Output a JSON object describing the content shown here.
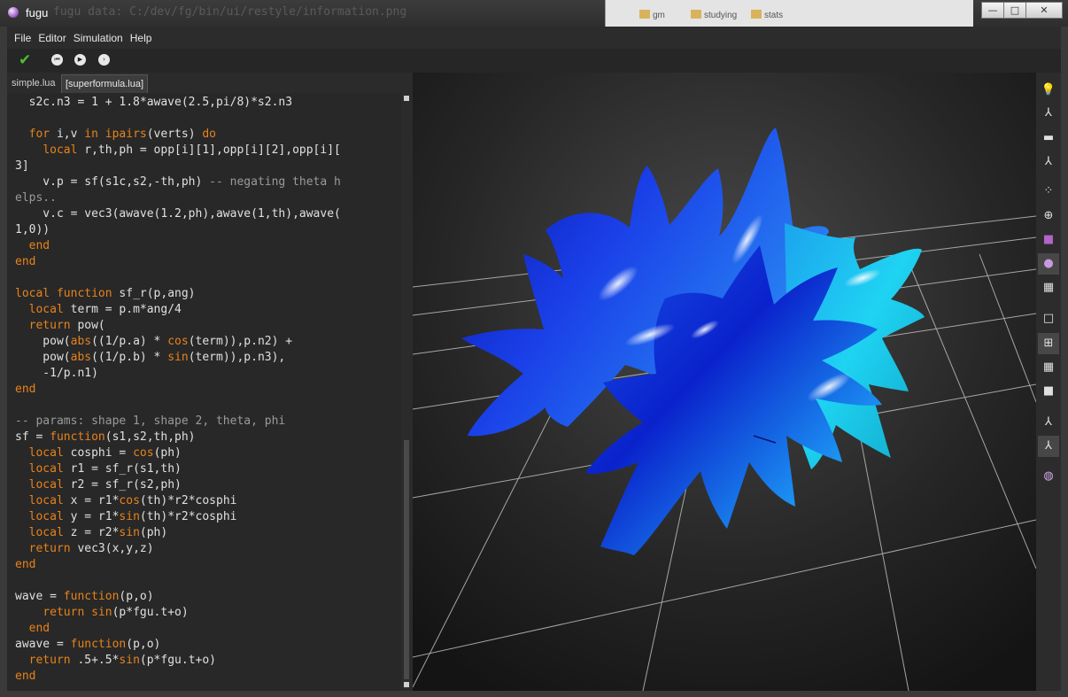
{
  "window": {
    "title": "fugu",
    "background_path_text": "fugu data: C:/dev/fg/bin/ui/restyle/information.png",
    "behind_tabs": [
      "gm",
      "studying",
      "stats"
    ],
    "controls": {
      "minimize": "—",
      "maximize": "□",
      "close": "✕"
    }
  },
  "menubar": {
    "items": [
      "File",
      "Editor",
      "Simulation",
      "Help"
    ]
  },
  "toolbar": {
    "check_icon": "check-icon",
    "buttons": [
      "restart-icon",
      "play-icon",
      "step-icon"
    ]
  },
  "tabs": [
    {
      "label": "simple.lua",
      "active": false
    },
    {
      "label": "[superformula.lua]",
      "active": true
    }
  ],
  "editor": {
    "lines": [
      [
        {
          "t": "  s2c.n3 = 1 + 1.8*awave(2.5,pi/8)*s2.n3",
          "c": ""
        }
      ],
      [
        {
          "t": "",
          "c": ""
        }
      ],
      [
        {
          "t": "  ",
          "c": ""
        },
        {
          "t": "for",
          "c": "kw"
        },
        {
          "t": " i,v ",
          "c": ""
        },
        {
          "t": "in",
          "c": "kw"
        },
        {
          "t": " ",
          "c": ""
        },
        {
          "t": "ipairs",
          "c": "kw"
        },
        {
          "t": "(verts) ",
          "c": ""
        },
        {
          "t": "do",
          "c": "kw"
        }
      ],
      [
        {
          "t": "    ",
          "c": ""
        },
        {
          "t": "local",
          "c": "kw"
        },
        {
          "t": " r,th,ph = opp[i][1],opp[i][2],opp[i][",
          "c": ""
        }
      ],
      [
        {
          "t": "3]",
          "c": ""
        }
      ],
      [
        {
          "t": "    v.p = sf(s1c,s2,-th,ph) ",
          "c": ""
        },
        {
          "t": "-- negating theta h",
          "c": "cm"
        }
      ],
      [
        {
          "t": "elps..",
          "c": "cm"
        }
      ],
      [
        {
          "t": "    v.c = vec3(awave(1.2,ph),awave(1,th),awave(",
          "c": ""
        }
      ],
      [
        {
          "t": "1,0))",
          "c": ""
        }
      ],
      [
        {
          "t": "  ",
          "c": ""
        },
        {
          "t": "end",
          "c": "kw"
        }
      ],
      [
        {
          "t": "end",
          "c": "kw"
        }
      ],
      [
        {
          "t": "",
          "c": ""
        }
      ],
      [
        {
          "t": "local",
          "c": "kw"
        },
        {
          "t": " ",
          "c": ""
        },
        {
          "t": "function",
          "c": "kw"
        },
        {
          "t": " sf_r(p,ang)",
          "c": ""
        }
      ],
      [
        {
          "t": "  ",
          "c": ""
        },
        {
          "t": "local",
          "c": "kw"
        },
        {
          "t": " term = p.m*ang/4",
          "c": ""
        }
      ],
      [
        {
          "t": "  ",
          "c": ""
        },
        {
          "t": "return",
          "c": "kw"
        },
        {
          "t": " pow(",
          "c": ""
        }
      ],
      [
        {
          "t": "    pow(",
          "c": ""
        },
        {
          "t": "abs",
          "c": "kw"
        },
        {
          "t": "((1/p.a) * ",
          "c": ""
        },
        {
          "t": "cos",
          "c": "kw"
        },
        {
          "t": "(term)),p.n2) +",
          "c": ""
        }
      ],
      [
        {
          "t": "    pow(",
          "c": ""
        },
        {
          "t": "abs",
          "c": "kw"
        },
        {
          "t": "((1/p.b) * ",
          "c": ""
        },
        {
          "t": "sin",
          "c": "kw"
        },
        {
          "t": "(term)),p.n3),",
          "c": ""
        }
      ],
      [
        {
          "t": "    -1/p.n1)",
          "c": ""
        }
      ],
      [
        {
          "t": "end",
          "c": "kw"
        }
      ],
      [
        {
          "t": "",
          "c": ""
        }
      ],
      [
        {
          "t": "-- params: shape 1, shape 2, theta, phi",
          "c": "cm"
        }
      ],
      [
        {
          "t": "sf = ",
          "c": ""
        },
        {
          "t": "function",
          "c": "kw"
        },
        {
          "t": "(s1,s2,th,ph)",
          "c": ""
        }
      ],
      [
        {
          "t": "  ",
          "c": ""
        },
        {
          "t": "local",
          "c": "kw"
        },
        {
          "t": " cosphi = ",
          "c": ""
        },
        {
          "t": "cos",
          "c": "kw"
        },
        {
          "t": "(ph)",
          "c": ""
        }
      ],
      [
        {
          "t": "  ",
          "c": ""
        },
        {
          "t": "local",
          "c": "kw"
        },
        {
          "t": " r1 = sf_r(s1,th)",
          "c": ""
        }
      ],
      [
        {
          "t": "  ",
          "c": ""
        },
        {
          "t": "local",
          "c": "kw"
        },
        {
          "t": " r2 = sf_r(s2,ph)",
          "c": ""
        }
      ],
      [
        {
          "t": "  ",
          "c": ""
        },
        {
          "t": "local",
          "c": "kw"
        },
        {
          "t": " x = r1*",
          "c": ""
        },
        {
          "t": "cos",
          "c": "kw"
        },
        {
          "t": "(th)*r2*cosphi",
          "c": ""
        }
      ],
      [
        {
          "t": "  ",
          "c": ""
        },
        {
          "t": "local",
          "c": "kw"
        },
        {
          "t": " y = r1*",
          "c": ""
        },
        {
          "t": "sin",
          "c": "kw"
        },
        {
          "t": "(th)*r2*cosphi",
          "c": ""
        }
      ],
      [
        {
          "t": "  ",
          "c": ""
        },
        {
          "t": "local",
          "c": "kw"
        },
        {
          "t": " z = r2*",
          "c": ""
        },
        {
          "t": "sin",
          "c": "kw"
        },
        {
          "t": "(ph)",
          "c": ""
        }
      ],
      [
        {
          "t": "  ",
          "c": ""
        },
        {
          "t": "return",
          "c": "kw"
        },
        {
          "t": " vec3(x,y,z)",
          "c": ""
        }
      ],
      [
        {
          "t": "end",
          "c": "kw"
        }
      ],
      [
        {
          "t": "",
          "c": ""
        }
      ],
      [
        {
          "t": "wave = ",
          "c": ""
        },
        {
          "t": "function",
          "c": "kw"
        },
        {
          "t": "(p,o)",
          "c": ""
        }
      ],
      [
        {
          "t": "    ",
          "c": ""
        },
        {
          "t": "return",
          "c": "kw"
        },
        {
          "t": " ",
          "c": ""
        },
        {
          "t": "sin",
          "c": "kw"
        },
        {
          "t": "(p*fgu.t+o)",
          "c": ""
        }
      ],
      [
        {
          "t": "  ",
          "c": ""
        },
        {
          "t": "end",
          "c": "kw"
        }
      ],
      [
        {
          "t": "awave = ",
          "c": ""
        },
        {
          "t": "function",
          "c": "kw"
        },
        {
          "t": "(p,o)",
          "c": ""
        }
      ],
      [
        {
          "t": "  ",
          "c": ""
        },
        {
          "t": "return",
          "c": "kw"
        },
        {
          "t": " .5+.5*",
          "c": ""
        },
        {
          "t": "sin",
          "c": "kw"
        },
        {
          "t": "(p*fgu.t+o)",
          "c": ""
        }
      ],
      [
        {
          "t": "end",
          "c": "kw"
        }
      ]
    ]
  },
  "sidebar": {
    "buttons": [
      {
        "name": "light-icon",
        "glyph": "💡",
        "active": false
      },
      {
        "name": "axes-icon",
        "glyph": "⅄",
        "active": false
      },
      {
        "name": "floor-icon",
        "glyph": "▬",
        "active": false
      },
      {
        "name": "axes-xyz-icon",
        "glyph": "⅄",
        "active": false
      },
      {
        "name": "points-icon",
        "glyph": "⁘",
        "active": false
      },
      {
        "name": "wire-sphere-icon",
        "glyph": "⊕",
        "active": false
      },
      {
        "name": "flat-shading-icon",
        "glyph": "■",
        "active": false
      },
      {
        "name": "smooth-shading-icon",
        "glyph": "●",
        "active": true
      },
      {
        "name": "checker-icon",
        "glyph": "▦",
        "active": false
      },
      {
        "name": "no-grid-icon",
        "glyph": "□",
        "active": false
      },
      {
        "name": "grid-4-icon",
        "glyph": "⊞",
        "active": true
      },
      {
        "name": "grid-fine-icon",
        "glyph": "▦",
        "active": false
      },
      {
        "name": "white-bg-icon",
        "glyph": "■",
        "active": false
      },
      {
        "name": "normals-icon",
        "glyph": "⅄",
        "active": false
      },
      {
        "name": "normals-colored-icon",
        "glyph": "⅄",
        "active": true
      },
      {
        "name": "sphere-globe-icon",
        "glyph": "◍",
        "active": false
      }
    ]
  },
  "colors": {
    "keyword": "#e8821a",
    "comment": "#9a9a9a",
    "shape_deep_blue": "#0a1ed8",
    "shape_cyan": "#19d8f0"
  }
}
